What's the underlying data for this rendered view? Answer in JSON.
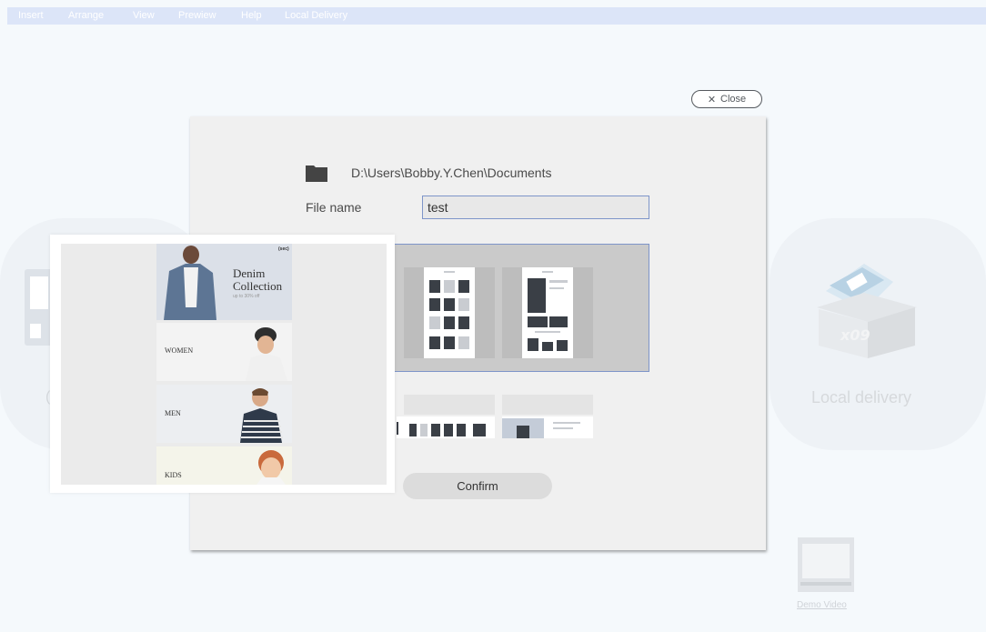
{
  "menu": [
    "Insert",
    "Arrange",
    "View",
    "Prewiew",
    "Help",
    "Local Delivery"
  ],
  "close_label": "Close",
  "background": {
    "left_label": "(",
    "local_delivery_label": "Local delivery",
    "box_text": "x09",
    "demo_video_label": "Demo Video"
  },
  "dialog": {
    "path": "D:\\Users\\Bobby.Y.Chen\\Documents",
    "file_name_label": "File name",
    "file_name_value": "test",
    "confirm_label": "Confirm"
  },
  "preview": {
    "badge": "(sec)",
    "banner1_title": "Denim Collection",
    "banner1_sub": "up to 30% off",
    "women": "WOMEN",
    "men": "MEN",
    "kids": "KIDS"
  }
}
